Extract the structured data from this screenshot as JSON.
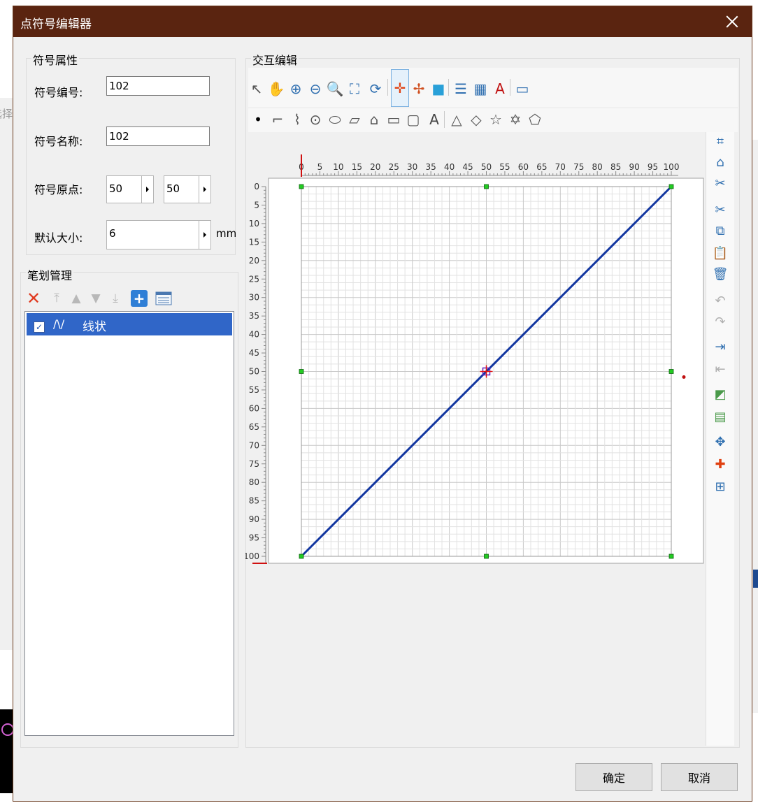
{
  "dialog": {
    "title": "点符号编辑器"
  },
  "background": {
    "partial_text": "选择"
  },
  "symbol_props": {
    "group_label": "符号属性",
    "number_label": "符号编号:",
    "number_value": "102",
    "name_label": "符号名称:",
    "name_value": "102",
    "origin_label": "符号原点:",
    "origin_x": "50",
    "origin_y": "50",
    "size_label": "默认大小:",
    "size_value": "6",
    "size_unit": "mm"
  },
  "stroke_mgmt": {
    "group_label": "笔划管理",
    "items": [
      {
        "type_glyph": "/\\/",
        "label": "线状",
        "checked": true
      }
    ]
  },
  "interactive": {
    "group_label": "交互编辑",
    "toolbar1": [
      "select-arrow-icon",
      "pan-hand-icon",
      "zoom-in-icon",
      "zoom-out-icon",
      "zoom-window-icon",
      "full-extent-icon",
      "refresh-icon",
      "set-origin-icon",
      "move-point-icon",
      "fill-icon",
      "lines-icon",
      "grid-icon",
      "text-color-icon",
      "window-icon"
    ],
    "toolbar2": [
      "point-icon",
      "polyline-icon",
      "bezier-icon",
      "circle-point-icon",
      "ellipse-icon",
      "parallelogram-icon",
      "arc-polygon-icon",
      "rectangle-icon",
      "rounded-rect-icon",
      "text-icon",
      "triangle-icon",
      "diamond-icon",
      "star-icon",
      "six-point-star-icon",
      "polygon-icon"
    ],
    "side_tools": [
      "add-vertex-icon",
      "shape-icon",
      "break-icon",
      "cut-icon",
      "copy-icon",
      "paste-icon",
      "delete-icon",
      "undo-icon",
      "redo-icon",
      "bring-front-icon",
      "send-back-icon",
      "fill-style-icon",
      "image-icon",
      "move-icon",
      "pick-point-icon",
      "grid-snap-icon"
    ]
  },
  "canvas": {
    "x_ticks": [
      "0",
      "5",
      "10",
      "15",
      "20",
      "25",
      "30",
      "35",
      "40",
      "45",
      "50",
      "55",
      "60",
      "65",
      "70",
      "75",
      "80",
      "85",
      "90",
      "95",
      "100"
    ],
    "y_ticks": [
      "0",
      "5",
      "10",
      "15",
      "20",
      "25",
      "30",
      "35",
      "40",
      "45",
      "50",
      "55",
      "60",
      "65",
      "70",
      "75",
      "80",
      "85",
      "90",
      "95",
      "100"
    ],
    "line_start": [
      0,
      100
    ],
    "line_end": [
      100,
      0
    ],
    "origin": [
      50,
      50
    ],
    "line_color": "#1236a0",
    "handle_color": "#22cc22"
  },
  "buttons": {
    "ok": "确定",
    "cancel": "取消"
  }
}
